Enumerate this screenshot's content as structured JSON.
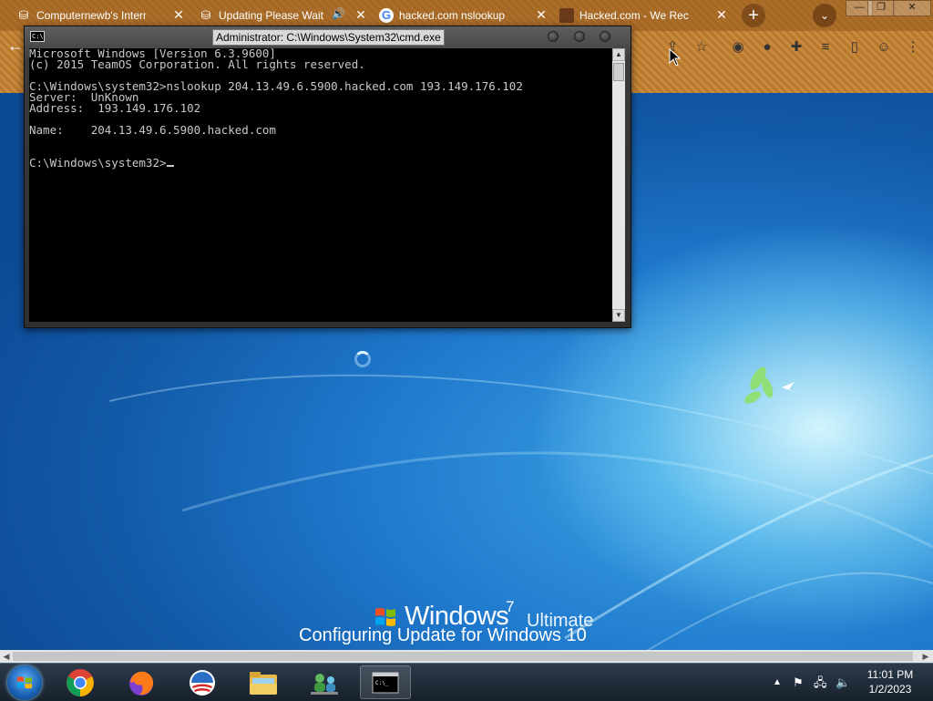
{
  "browser": {
    "tabs": [
      {
        "label": "Computernewb's Internet",
        "icon": "server-icon"
      },
      {
        "label": "Updating Please Wait",
        "icon": "server-icon",
        "audio": true
      },
      {
        "label": "hacked.com nslookup - Goo",
        "icon": "google-icon"
      },
      {
        "label": "Hacked.com - We Recover",
        "icon": "hacked-icon"
      }
    ],
    "new_tab": "+",
    "window_controls": {
      "minimize": "—",
      "restore": "❐",
      "close": "✕"
    }
  },
  "cmd": {
    "title": "Administrator: C:\\Windows\\System32\\cmd.exe",
    "lines": [
      "Microsoft Windows [Version 6.3.9600]",
      "(c) 2015 TeamOS Corporation. All rights reserved.",
      "",
      "C:\\Windows\\system32>nslookup 204.13.49.6.5900.hacked.com 193.149.176.102",
      "Server:  UnKnown",
      "Address:  193.149.176.102",
      "",
      "Name:    204.13.49.6.5900.hacked.com",
      "",
      ""
    ],
    "prompt": "C:\\Windows\\system32>"
  },
  "desktop": {
    "brand_word": "Windows",
    "brand_version": "7",
    "brand_edition": "Ultimate",
    "status_message": "Configuring Update for Windows 10"
  },
  "taskbar": {
    "apps": [
      {
        "name": "chrome",
        "icon": "chrome-icon"
      },
      {
        "name": "firefox",
        "icon": "firefox-icon"
      },
      {
        "name": "obama",
        "icon": "obama-logo-icon"
      },
      {
        "name": "explorer",
        "icon": "folder-icon"
      },
      {
        "name": "network",
        "icon": "network-people-icon"
      },
      {
        "name": "cmd",
        "icon": "cmd-icon",
        "active": true
      }
    ],
    "clock_time": "11:01 PM",
    "clock_date": "1/2/2023"
  },
  "colors": {
    "desktop_blue": "#1f78cc",
    "chrome_bar": "#c08034",
    "console_bg": "#000000",
    "console_fg": "#c8c8c8"
  }
}
